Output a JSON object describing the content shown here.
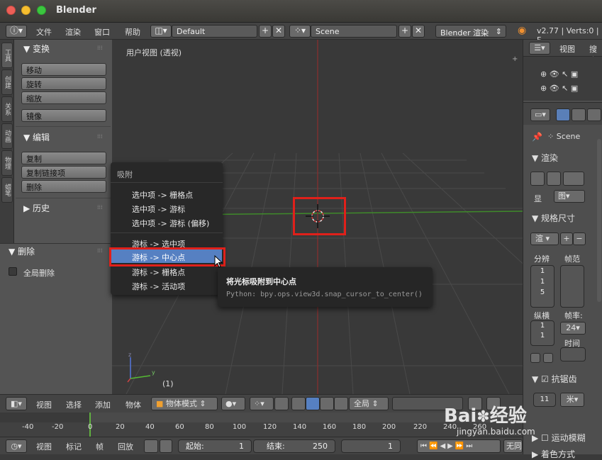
{
  "window": {
    "title": "Blender"
  },
  "menubar": {
    "items": [
      "文件",
      "渲染",
      "窗口",
      "帮助"
    ],
    "layout": "Default",
    "scene": "Scene",
    "engine": "Blender 渲染",
    "version": "v2.77 | Verts:0 | F"
  },
  "left_tabs": [
    "工具",
    "创建",
    "关系",
    "动画",
    "物理",
    "蜡笔"
  ],
  "tool_panel": {
    "transform": {
      "header": "变换",
      "buttons": [
        "移动",
        "旋转",
        "缩放",
        "镜像"
      ]
    },
    "edit": {
      "header": "编辑",
      "buttons": [
        "复制",
        "复制链接项",
        "删除"
      ]
    },
    "history": {
      "header": "历史"
    }
  },
  "operator_panel": {
    "header": "删除",
    "checkbox_label": "全局删除"
  },
  "viewport": {
    "label": "用户视图 (透视)",
    "frame": "(1)"
  },
  "snap_menu": {
    "title": "吸附",
    "items": [
      "选中项 -> 栅格点",
      "选中项 -> 游标",
      "选中项 -> 游标 (偏移)",
      "游标 -> 选中项",
      "游标 -> 中心点",
      "游标 -> 栅格点",
      "游标 -> 活动项"
    ],
    "highlighted": "游标 -> 中心点"
  },
  "tooltip": {
    "title": "将光标吸附到中心点",
    "python": "Python: bpy.ops.view3d.snap_cursor_to_center()"
  },
  "outliner": {
    "view": "视图",
    "search": "搜索"
  },
  "properties": {
    "scene": "Scene",
    "render": "渲染",
    "display_label": "显",
    "display_value": "图",
    "dimensions": "规格尺寸",
    "preset": "渲",
    "resolution_label": "分辨",
    "frame_range_label": "帧范",
    "res_values": [
      "1",
      "1",
      "5"
    ],
    "aspect_label": "纵横",
    "fps_label": "帧率:",
    "aspect_values": [
      "1",
      "1"
    ],
    "fps_value": "24",
    "time_label": "时间",
    "antialias": "抗锯齿",
    "aa_value": "11",
    "aa_unit": "米",
    "motion_blur": "运动模糊",
    "shading": "着色方式"
  },
  "view_header": {
    "items": [
      "视图",
      "选择",
      "添加",
      "物体"
    ],
    "mode": "物体模式",
    "global": "全局"
  },
  "timeline": {
    "ticks": [
      "-40",
      "-20",
      "0",
      "20",
      "40",
      "60",
      "80",
      "100",
      "120",
      "140",
      "160",
      "180",
      "200",
      "220",
      "240",
      "260"
    ]
  },
  "timeline_footer": {
    "items": [
      "视图",
      "标记",
      "帧",
      "回放"
    ],
    "start_label": "起始:",
    "start_value": "1",
    "end_label": "结束:",
    "end_value": "250",
    "current": "1",
    "no_sync": "无同"
  },
  "watermark": {
    "brand": "Bai",
    "brand2": "经验",
    "url": "jingyan.baidu.com"
  },
  "colors": {
    "highlight": "#5680c2",
    "red_box": "#e0201a",
    "x_axis": "#b03a3a",
    "y_axis": "#4a9a2a"
  }
}
